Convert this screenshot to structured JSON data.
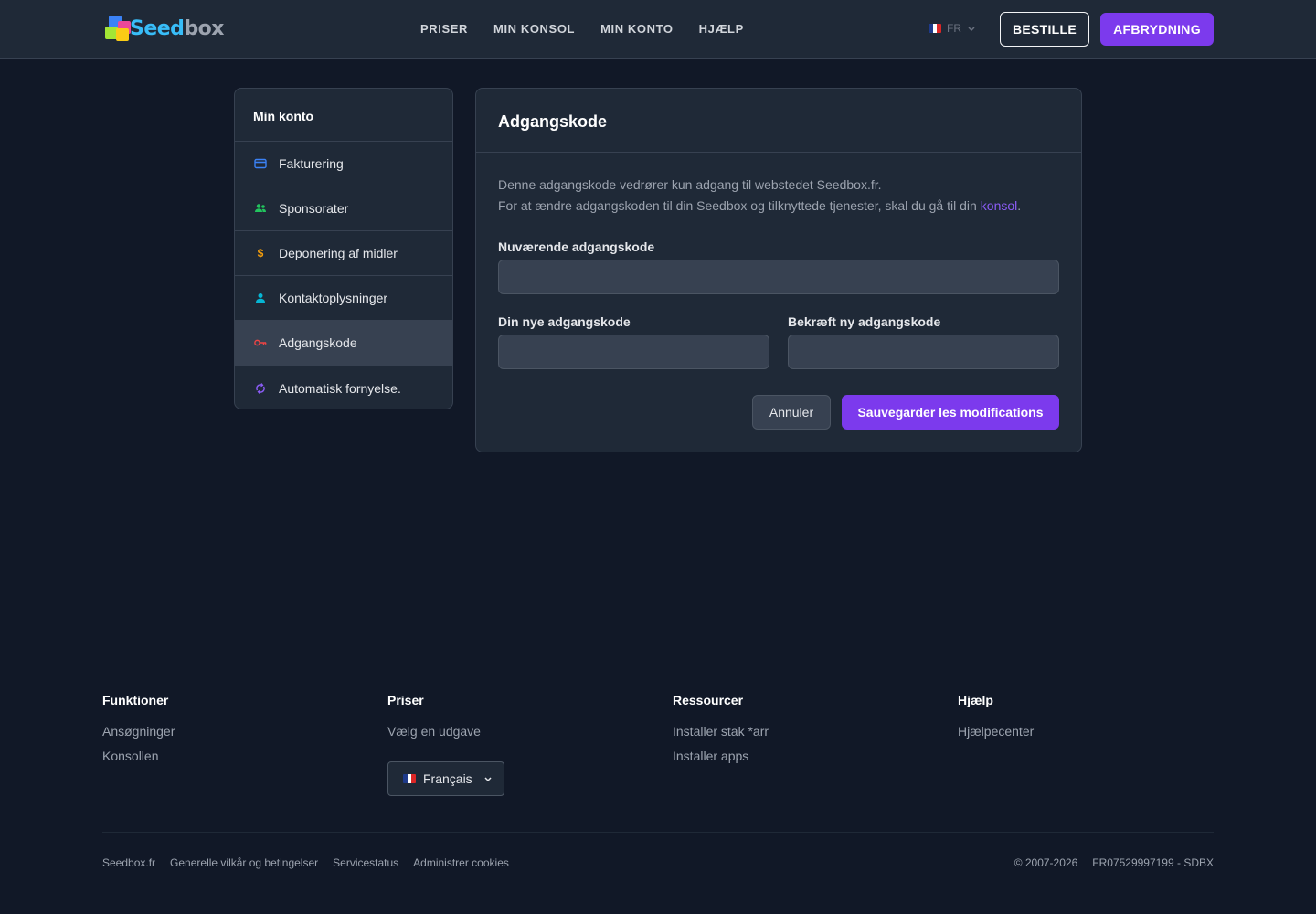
{
  "header": {
    "logo_text_1": "Seed",
    "logo_text_2": "box",
    "nav": [
      "PRISER",
      "MIN KONSOL",
      "MIN KONTO",
      "HJÆLP"
    ],
    "lang_code": "FR",
    "order_label": "BESTILLE",
    "cancel_label": "AFBRYDNING"
  },
  "sidebar": {
    "title": "Min konto",
    "items": [
      {
        "label": "Fakturering",
        "icon": "credit-card-icon",
        "color": "#3b82f6"
      },
      {
        "label": "Sponsorater",
        "icon": "users-icon",
        "color": "#22c55e"
      },
      {
        "label": "Deponering af midler",
        "icon": "dollar-icon",
        "color": "#f59e0b"
      },
      {
        "label": "Kontaktoplysninger",
        "icon": "user-icon",
        "color": "#06b6d4"
      },
      {
        "label": "Adgangskode",
        "icon": "key-icon",
        "color": "#ef4444"
      },
      {
        "label": "Automatisk fornyelse.",
        "icon": "refresh-icon",
        "color": "#8b5cf6"
      }
    ]
  },
  "form": {
    "title": "Adgangskode",
    "desc_line1": "Denne adgangskode vedrører kun adgang til webstedet Seedbox.fr.",
    "desc_line2": "For at ændre adgangskoden til din Seedbox og tilknyttede tjenester, skal du gå til din",
    "desc_link": "konsol",
    "current_label": "Nuværende adgangskode",
    "new_label": "Din nye adgangskode",
    "confirm_label": "Bekræft ny adgangskode",
    "cancel": "Annuler",
    "save": "Sauvegarder les modifications"
  },
  "footer": {
    "cols": [
      {
        "title": "Funktioner",
        "links": [
          "Ansøgninger",
          "Konsollen"
        ]
      },
      {
        "title": "Priser",
        "links": [
          "Vælg en udgave"
        ]
      },
      {
        "title": "Ressourcer",
        "links": [
          "Installer stak *arr",
          "Installer apps"
        ]
      },
      {
        "title": "Hjælp",
        "links": [
          "Hjælpecenter"
        ]
      }
    ],
    "language": "Français",
    "bottom_links": [
      "Seedbox.fr",
      "Generelle vilkår og betingelser",
      "Servicestatus",
      "Administrer cookies"
    ],
    "copyright": "© 2007-2026",
    "company_id": "FR07529997199 - SDBX"
  },
  "colors": {
    "accent": "#7c3aed",
    "link": "#8b5cf6",
    "active_item_bg": "#374151"
  }
}
